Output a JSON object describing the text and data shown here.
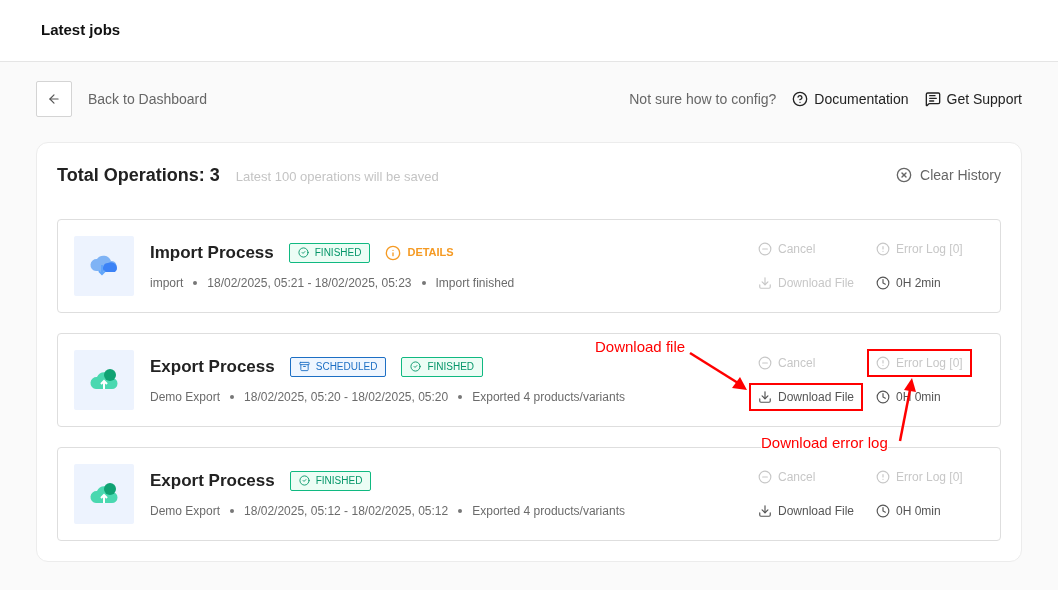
{
  "header": {
    "title": "Latest jobs"
  },
  "toolbar": {
    "back_label": "Back to Dashboard",
    "hint": "Not sure how to config?",
    "links": [
      "Documentation",
      "Get Support"
    ]
  },
  "operations": {
    "title": "Total Operations: 3",
    "note": "Latest 100 operations will be saved",
    "clear_label": "Clear History",
    "rows": [
      {
        "kind": "import",
        "title": "Import Process",
        "badges": [
          {
            "kind": "finished",
            "label": "FINISHED"
          }
        ],
        "details": "DETAILS",
        "meta": [
          "import",
          "18/02/2025, 05:21 - 18/02/2025, 05:23",
          "Import finished"
        ],
        "cancel": {
          "label": "Cancel",
          "disabled": true,
          "highlighted": false
        },
        "error_log": {
          "label": "Error Log [0]",
          "disabled": true,
          "highlighted": false
        },
        "download": {
          "label": "Download File",
          "disabled": true,
          "highlighted": false
        },
        "duration": "0H 2min"
      },
      {
        "kind": "export",
        "title": "Export Process",
        "badges": [
          {
            "kind": "scheduled",
            "label": "SCHEDULED"
          },
          {
            "kind": "finished",
            "label": "FINISHED"
          }
        ],
        "meta": [
          "Demo Export",
          "18/02/2025, 05:20 - 18/02/2025, 05:20",
          "Exported 4 products/variants"
        ],
        "cancel": {
          "label": "Cancel",
          "disabled": true,
          "highlighted": false
        },
        "error_log": {
          "label": "Error Log [0]",
          "disabled": true,
          "highlighted": true
        },
        "download": {
          "label": "Download File",
          "disabled": false,
          "highlighted": true
        },
        "duration": "0H 0min"
      },
      {
        "kind": "export",
        "title": "Export Process",
        "badges": [
          {
            "kind": "finished",
            "label": "FINISHED"
          }
        ],
        "meta": [
          "Demo Export",
          "18/02/2025, 05:12 - 18/02/2025, 05:12",
          "Exported 4 products/variants"
        ],
        "cancel": {
          "label": "Cancel",
          "disabled": true,
          "highlighted": false
        },
        "error_log": {
          "label": "Error Log [0]",
          "disabled": true,
          "highlighted": false
        },
        "download": {
          "label": "Download File",
          "disabled": false,
          "highlighted": false
        },
        "duration": "0H 0min"
      }
    ]
  },
  "annotations": [
    {
      "text": "Download file"
    },
    {
      "text": "Download error log"
    }
  ]
}
